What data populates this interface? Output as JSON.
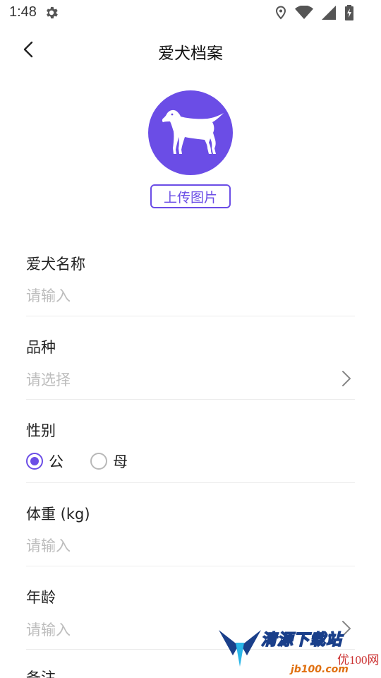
{
  "status_bar": {
    "time": "1:48",
    "icons": [
      "gear-icon",
      "location-icon",
      "wifi-icon",
      "signal-icon",
      "battery-icon"
    ]
  },
  "header": {
    "title": "爱犬档案",
    "back_icon": "chevron-left-icon"
  },
  "avatar": {
    "icon": "dog-icon",
    "bg_color": "#6b4de6",
    "upload_label": "上传图片"
  },
  "form": {
    "name": {
      "label": "爱犬名称",
      "placeholder": "请输入",
      "value": ""
    },
    "breed": {
      "label": "品种",
      "placeholder": "请选择"
    },
    "gender": {
      "label": "性别",
      "options": [
        "公",
        "母"
      ],
      "selected": "公"
    },
    "weight": {
      "label": "体重 (kg)",
      "placeholder": "请输入",
      "value": ""
    },
    "age": {
      "label": "年龄",
      "placeholder": "请输入"
    },
    "notes": {
      "label": "备注"
    }
  },
  "watermark": {
    "brand": "清源下载站",
    "site": "优100网",
    "url": "jb100.com"
  },
  "colors": {
    "accent": "#6b4de6",
    "placeholder": "#bdbdbd",
    "divider": "#ececec"
  }
}
